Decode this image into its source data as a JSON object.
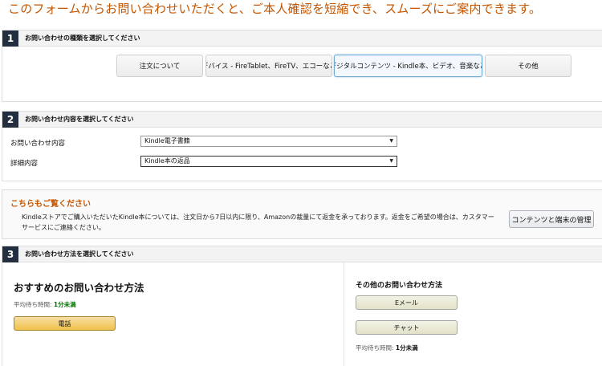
{
  "headline": "このフォームからお問い合わせいただくと、ご本人確認を短縮でき、スムーズにご案内できます。",
  "section1": {
    "number": "1",
    "title": "お問い合わせの種類を選択してください",
    "topics": [
      {
        "label": "注文について",
        "selected": false
      },
      {
        "label": "デバイス - FireTablet、FireTV、エコーなど",
        "selected": false
      },
      {
        "label": "デジタルコンテンツ - Kindle本、ビデオ、音楽など",
        "selected": true
      },
      {
        "label": "その他",
        "selected": false
      }
    ]
  },
  "section2": {
    "number": "2",
    "title": "お問い合わせ内容を選択してください",
    "fields": [
      {
        "label": "お問い合わせ内容",
        "value": "Kindle電子書籍"
      },
      {
        "label": "詳細内容",
        "value": "Kindle本の返品"
      }
    ]
  },
  "notice": {
    "title": "こちらもご覧ください",
    "text": "Kindleストアでご購入いただいたKindle本については、注文日から7日以内に限り、Amazonの裁量にて返金を承っております。返金をご希望の場合は、カスタマーサービスにご連絡ください。",
    "button_label": "コンテンツと端末の管理"
  },
  "section3": {
    "number": "3",
    "title": "お問い合わせ方法を選択してください",
    "recommended": {
      "title": "おすすめのお問い合わせ方法",
      "wait_label": "平均待ち時間: ",
      "wait_value": "1分未満",
      "button_label": "電話"
    },
    "other": {
      "title": "その他のお問い合わせ方法",
      "email_label": "Eメール",
      "chat_label": "チャット",
      "wait_label": "平均待ち時間: ",
      "wait_value": "1分未満"
    }
  },
  "colors": {
    "accent": "#c45500",
    "step_badge": "#232f3e",
    "primary_button": "#f0c14b",
    "wait_green": "#007600"
  }
}
